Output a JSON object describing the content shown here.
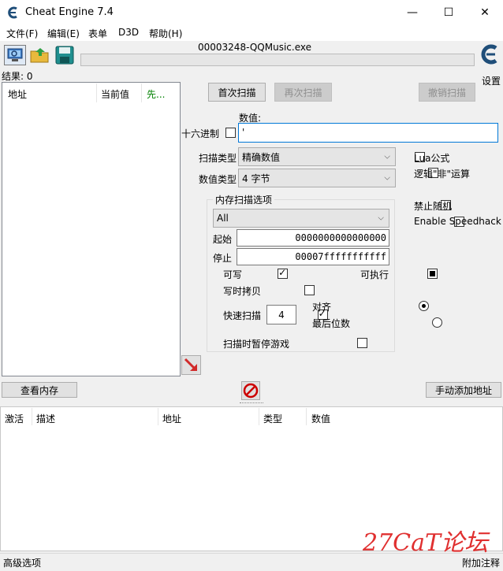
{
  "window": {
    "title": "Cheat Engine 7.4",
    "minimize": "—",
    "maximize": "☐",
    "close": "✕"
  },
  "menu": [
    "文件(F)",
    "编辑(E)",
    "表单",
    "D3D",
    "帮助(H)"
  ],
  "process": "00003248-QQMusic.exe",
  "settings_label": "设置",
  "results_label": "结果: 0",
  "result_columns": {
    "address": "地址",
    "current": "当前值",
    "previous": "先..."
  },
  "scan": {
    "first_scan": "首次扫描",
    "next_scan": "再次扫描",
    "undo_scan": "撤销扫描",
    "value_label": "数值:",
    "hex_label": "十六进制",
    "value_input": "'",
    "scan_type_label": "扫描类型",
    "scan_type_value": "精确数值",
    "value_type_label": "数值类型",
    "value_type_value": "4 字节",
    "lua_formula": "Lua公式",
    "not_logic": "逻辑\"非\"运算",
    "no_random": "禁止随机",
    "speedhack": "Enable Speedhack"
  },
  "memory": {
    "group_title": "内存扫描选项",
    "region": "All",
    "start_label": "起始",
    "start_value": "0000000000000000",
    "stop_label": "停止",
    "stop_value": "00007fffffffffff",
    "writable": "可写",
    "executable": "可执行",
    "copy_on_write": "写时拷贝",
    "fast_scan": "快速扫描",
    "fast_scan_value": "4",
    "align": "对齐",
    "last_digits": "最后位数",
    "pause_game": "扫描时暂停游戏"
  },
  "view_memory": "查看内存",
  "add_address": "手动添加地址",
  "address_columns": {
    "active": "激活",
    "description": "描述",
    "address": "地址",
    "type": "类型",
    "value": "数值"
  },
  "footer": {
    "advanced": "高级选项",
    "comments": "附加注释"
  },
  "watermark": "27CaT论坛",
  "colors": {
    "previous_col": "#008000",
    "stop_red": "#cc0000",
    "watermark": "#e03030"
  }
}
